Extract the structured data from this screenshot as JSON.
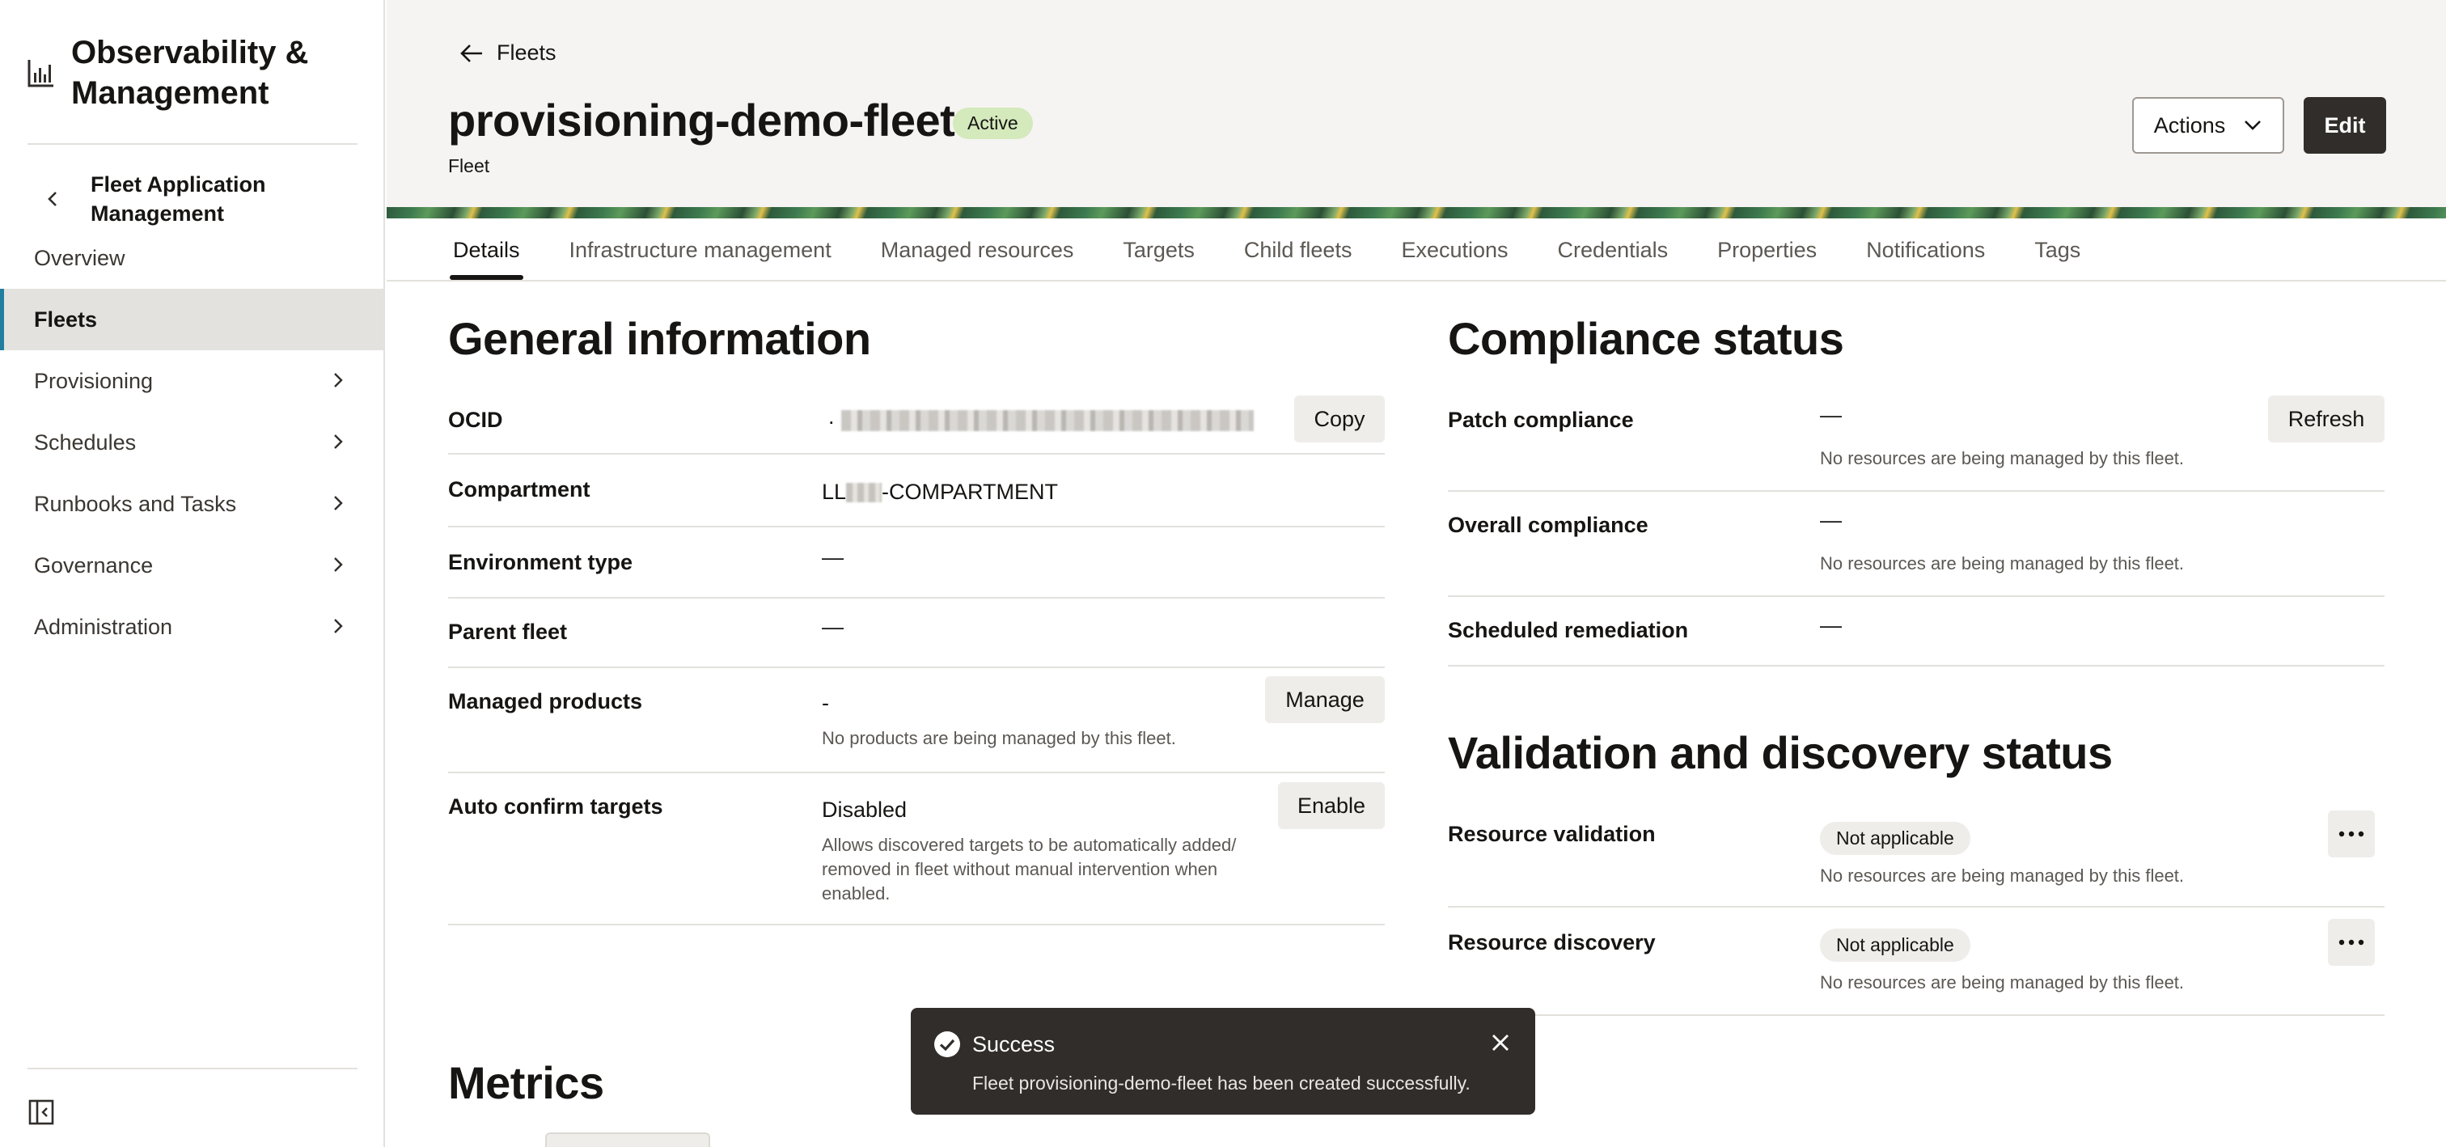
{
  "sidebar": {
    "app_title": "Observability & Management",
    "app_icon": "chart-icon",
    "back_label": "Fleet Application Management",
    "items": [
      {
        "label": "Overview",
        "active": false,
        "has_children": false
      },
      {
        "label": "Fleets",
        "active": true,
        "has_children": false
      },
      {
        "label": "Provisioning",
        "active": false,
        "has_children": true
      },
      {
        "label": "Schedules",
        "active": false,
        "has_children": true
      },
      {
        "label": "Runbooks and Tasks",
        "active": false,
        "has_children": true
      },
      {
        "label": "Governance",
        "active": false,
        "has_children": true
      },
      {
        "label": "Administration",
        "active": false,
        "has_children": true
      }
    ],
    "collapse_icon": "sidebar-collapse-icon"
  },
  "header": {
    "back_label": "Fleets",
    "title": "provisioning-demo-fleet",
    "status": "Active",
    "subtitle": "Fleet",
    "actions_label": "Actions",
    "edit_label": "Edit"
  },
  "tabs": [
    {
      "label": "Details",
      "active": true
    },
    {
      "label": "Infrastructure management",
      "active": false
    },
    {
      "label": "Managed resources",
      "active": false
    },
    {
      "label": "Targets",
      "active": false
    },
    {
      "label": "Child fleets",
      "active": false
    },
    {
      "label": "Executions",
      "active": false
    },
    {
      "label": "Credentials",
      "active": false
    },
    {
      "label": "Properties",
      "active": false
    },
    {
      "label": "Notifications",
      "active": false
    },
    {
      "label": "Tags",
      "active": false
    }
  ],
  "general": {
    "heading": "General information",
    "ocid_label": "OCID",
    "ocid_value_prefix": ".",
    "copy_label": "Copy",
    "compartment_label": "Compartment",
    "compartment_prefix": "LL",
    "compartment_suffix": "-COMPARTMENT",
    "environment_label": "Environment type",
    "environment_value": "—",
    "parent_label": "Parent fleet",
    "parent_value": "—",
    "products_label": "Managed products",
    "products_value": "-",
    "products_note": "No products are being managed by this fleet.",
    "manage_label": "Manage",
    "auto_label": "Auto confirm targets",
    "auto_value": "Disabled",
    "auto_note": "Allows discovered targets to be automatically added/ removed in fleet without manual intervention when enabled.",
    "enable_label": "Enable"
  },
  "compliance": {
    "heading": "Compliance status",
    "patch_label": "Patch compliance",
    "patch_value": "—",
    "patch_note": "No resources are being managed by this fleet.",
    "refresh_label": "Refresh",
    "overall_label": "Overall compliance",
    "overall_value": "—",
    "overall_note": "No resources are being managed by this fleet.",
    "remediation_label": "Scheduled remediation",
    "remediation_value": "—"
  },
  "validation": {
    "heading": "Validation and discovery status",
    "resource_validation_label": "Resource validation",
    "resource_validation_status": "Not applicable",
    "resource_validation_note": "No resources are being managed by this fleet.",
    "resource_discovery_label": "Resource discovery",
    "resource_discovery_status": "Not applicable",
    "resource_discovery_note": "No resources are being managed by this fleet."
  },
  "metrics": {
    "heading": "Metrics"
  },
  "toast": {
    "title": "Success",
    "message": "Fleet provisioning-demo-fleet has been created successfully."
  },
  "colors": {
    "accent": "#227e9e",
    "badge_active": "#d4e9bc",
    "primary_button": "#312d2a",
    "toast_bg": "#312d2a"
  }
}
